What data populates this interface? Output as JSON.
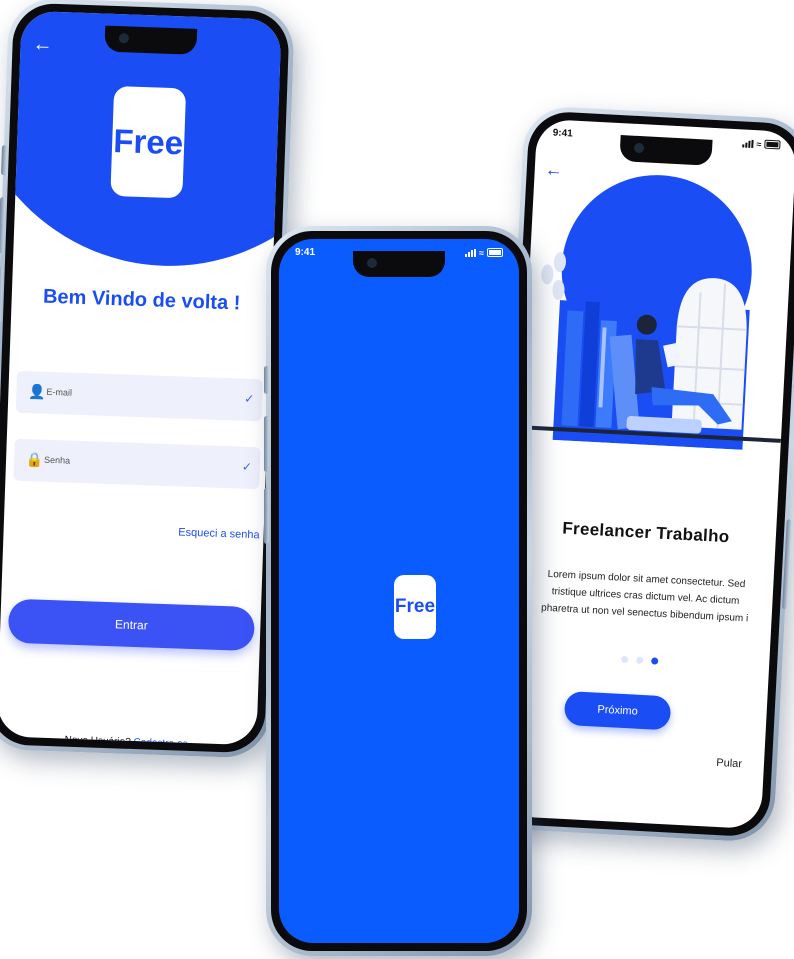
{
  "login": {
    "logo": "Free",
    "welcome": "Bem Vindo de volta !",
    "email_label": "E-mail",
    "password_label": "Senha",
    "forgot": "Esqueci a senha",
    "submit": "Entrar",
    "new_user": "Novo Usuário?",
    "signup_link": "Cadastre-se"
  },
  "splash": {
    "time": "9:41",
    "logo": "Free"
  },
  "onboarding": {
    "time": "9:41",
    "title": "Freelancer  Trabalho",
    "description_lines": [
      "Lorem ipsum dolor sit amet consectetur. Sed",
      "tristique ultrices cras dictum vel. Ac dictum",
      "pharetra ut non vel senectus bibendum ipsum i"
    ],
    "page_indicator": {
      "total": 3,
      "active": 3
    },
    "next": "Próximo",
    "skip": "Pular"
  },
  "colors": {
    "brand": "#1a4ef4",
    "splash_bg": "#0b5cff",
    "field_bg": "#eef0fb"
  },
  "icons": [
    "back-arrow-icon",
    "user-icon",
    "lock-icon",
    "check-icon",
    "signal-icon",
    "wifi-icon",
    "battery-icon"
  ]
}
